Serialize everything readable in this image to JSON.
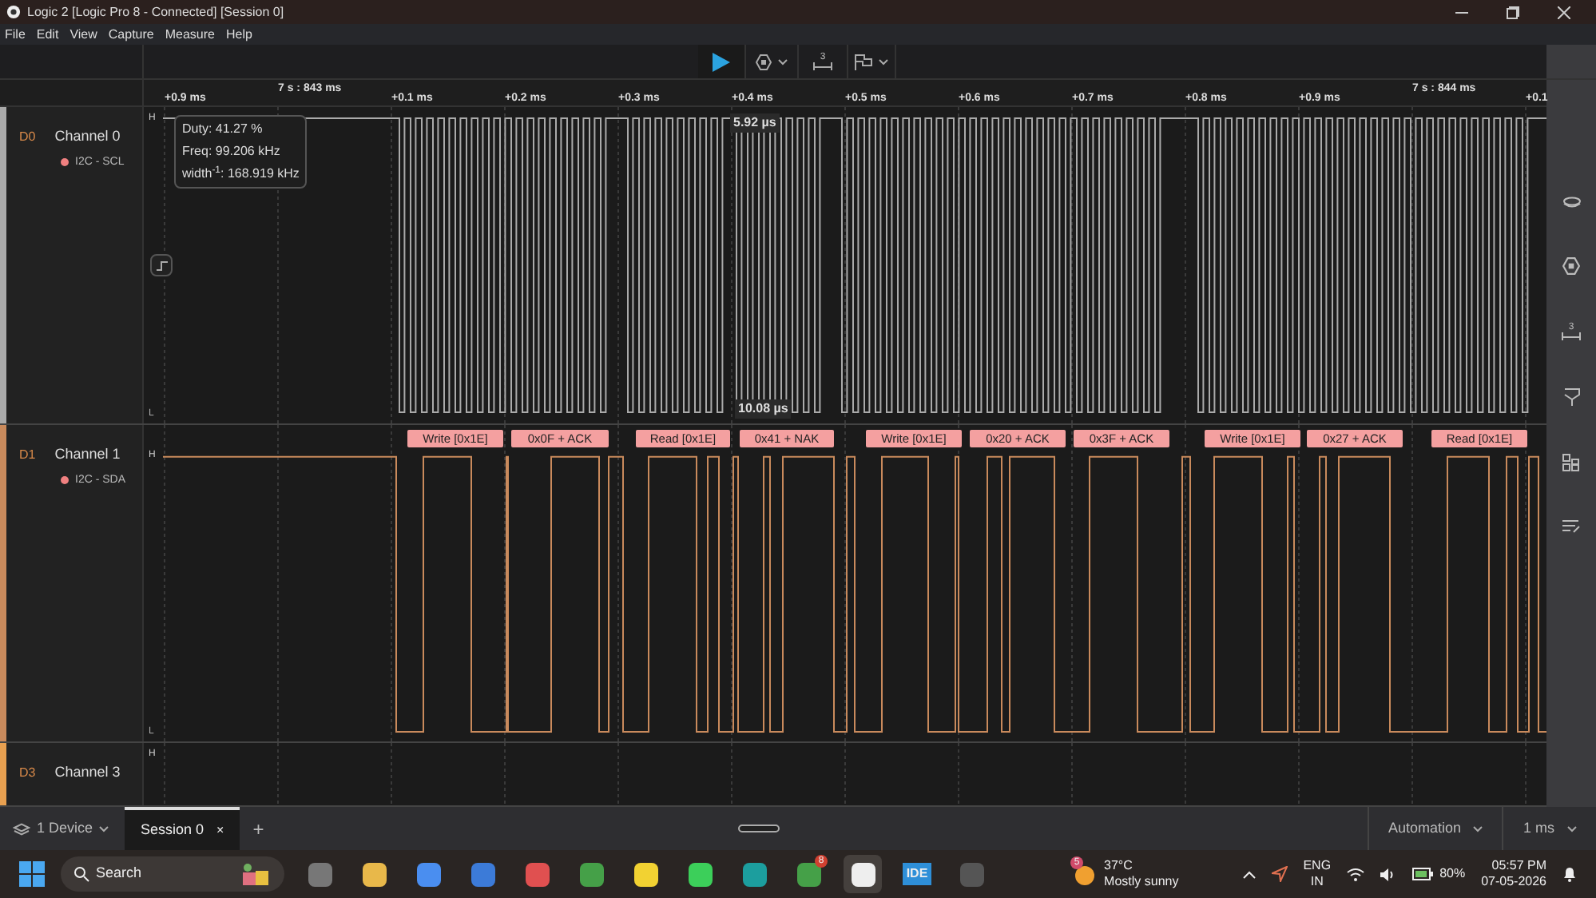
{
  "window": {
    "title": "Logic 2 [Logic Pro 8 - Connected] [Session 0]"
  },
  "menu": [
    "File",
    "Edit",
    "View",
    "Capture",
    "Measure",
    "Help"
  ],
  "toolbar": {
    "measure_count": "3"
  },
  "ruler": [
    {
      "kind": "minor",
      "label": "+0.9 ms"
    },
    {
      "kind": "major",
      "label": "7 s : 843 ms"
    },
    {
      "kind": "minor",
      "label": "+0.1 ms"
    },
    {
      "kind": "minor",
      "label": "+0.2 ms"
    },
    {
      "kind": "minor",
      "label": "+0.3 ms"
    },
    {
      "kind": "minor",
      "label": "+0.4 ms"
    },
    {
      "kind": "minor",
      "label": "+0.5 ms"
    },
    {
      "kind": "minor",
      "label": "+0.6 ms"
    },
    {
      "kind": "minor",
      "label": "+0.7 ms"
    },
    {
      "kind": "minor",
      "label": "+0.8 ms"
    },
    {
      "kind": "minor",
      "label": "+0.9 ms"
    },
    {
      "kind": "major",
      "label": "7 s : 844 ms"
    },
    {
      "kind": "minor",
      "label": "+0.1"
    }
  ],
  "channels": [
    {
      "kind": "clock",
      "id": "D0",
      "name": "Channel 0",
      "analyzer": "I2C - SCL",
      "color": "#aaaaaa",
      "high_marker": "H",
      "low_marker": "L",
      "measurement": {
        "lines": [
          "Duty: 41.27 %",
          "Freq: 99.206 kHz",
          "width$^{-1}$: 168.919 kHz"
        ],
        "top_label": "5.92 µs",
        "bottom_label": "10.08 µs"
      }
    },
    {
      "kind": "data",
      "id": "D1",
      "name": "Channel 1",
      "analyzer": "I2C - SDA",
      "color": "#c98a5c",
      "high_marker": "H",
      "low_marker": "L",
      "frames": [
        "Write [0x1E]",
        "0x0F + ACK",
        "Read [0x1E]",
        "0x41 + NAK",
        "Write [0x1E]",
        "0x20 + ACK",
        "0x3F + ACK",
        "Write [0x1E]",
        "0x27 + ACK",
        "Read [0x1E]"
      ]
    },
    {
      "kind": "empty",
      "id": "D3",
      "name": "Channel 3",
      "color": "#e8a050",
      "high_marker": "H"
    }
  ],
  "sidebar": {
    "measure_count": "3"
  },
  "bottom_bar": {
    "device": "1 Device",
    "session": {
      "label": "Session 0",
      "close": "×"
    },
    "add": "+",
    "trigger": "Automation",
    "duration": "1 ms"
  },
  "taskbar": {
    "search": "Search",
    "weather": {
      "badge": "5",
      "temperature": "37°C",
      "condition": "Mostly sunny"
    },
    "apps": [
      {
        "kind": "icon"
      },
      {
        "kind": "icon"
      },
      {
        "kind": "icon"
      },
      {
        "kind": "icon"
      },
      {
        "kind": "icon"
      },
      {
        "kind": "icon"
      },
      {
        "kind": "icon"
      },
      {
        "kind": "icon"
      },
      {
        "kind": "icon"
      },
      {
        "kind": "icon",
        "badge": "8"
      },
      {
        "kind": "icon",
        "selected": true
      },
      {
        "kind": "text",
        "label": "IDE"
      },
      {
        "kind": "icon"
      }
    ],
    "language": [
      "ENG",
      "IN"
    ],
    "battery": "80%",
    "time": "05:57 PM",
    "date": "07-05-2026"
  }
}
